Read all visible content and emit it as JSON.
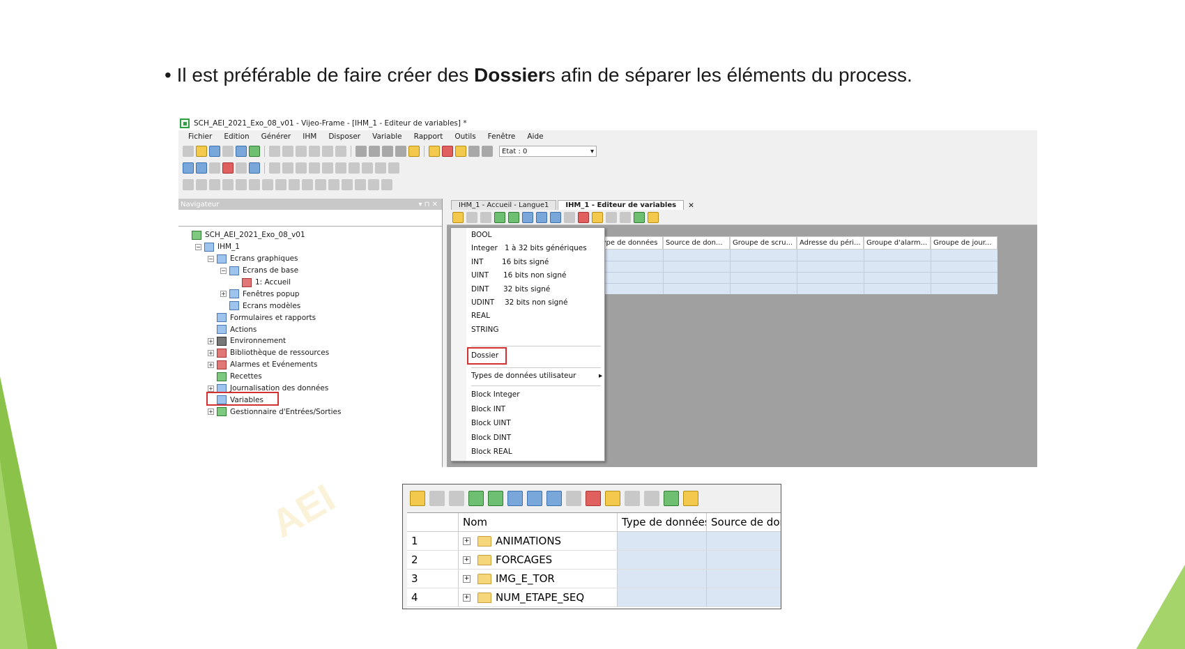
{
  "slide": {
    "bullet_prefix": "Il est préférable de faire créer des ",
    "bullet_bold": "Dossier",
    "bullet_suffix": "s afin de séparer les éléments du process.",
    "watermark": "AEI",
    "accent_color": "#8bc34a"
  },
  "app": {
    "title": "SCH_AEI_2021_Exo_08_v01 - Vijeo-Frame - [IHM_1 - Editeur de variables] *",
    "menu": [
      "Fichier",
      "Edition",
      "Générer",
      "IHM",
      "Disposer",
      "Variable",
      "Rapport",
      "Outils",
      "Fenêtre",
      "Aide"
    ],
    "etat_label": "Etat : 0",
    "navigator": {
      "header": "Navigateur",
      "tree": [
        {
          "label": "SCH_AEI_2021_Exo_08_v01",
          "level": 0,
          "icon": "project-icon"
        },
        {
          "label": "IHM_1",
          "level": 1,
          "icon": "hmi-icon"
        },
        {
          "label": "Ecrans graphiques",
          "level": 2,
          "icon": "screens-icon"
        },
        {
          "label": "Ecrans de base",
          "level": 3,
          "icon": "screens-icon"
        },
        {
          "label": "1: Accueil",
          "level": 4,
          "icon": "screen-page-icon"
        },
        {
          "label": "Fenêtres popup",
          "level": 3,
          "icon": "popup-icon"
        },
        {
          "label": "Ecrans modèles",
          "level": 3,
          "icon": "template-icon"
        },
        {
          "label": "Formulaires et rapports",
          "level": 2,
          "icon": "forms-icon"
        },
        {
          "label": "Actions",
          "level": 2,
          "icon": "actions-icon"
        },
        {
          "label": "Environnement",
          "level": 2,
          "icon": "environment-icon"
        },
        {
          "label": "Bibliothèque de ressources",
          "level": 2,
          "icon": "library-icon"
        },
        {
          "label": "Alarmes et Evénements",
          "level": 2,
          "icon": "alarms-icon"
        },
        {
          "label": "Recettes",
          "level": 2,
          "icon": "recipes-icon"
        },
        {
          "label": "Journalisation des données",
          "level": 2,
          "icon": "logging-icon"
        },
        {
          "label": "Variables",
          "level": 2,
          "icon": "variables-icon"
        },
        {
          "label": "Gestionnaire d'Entrées/Sorties",
          "level": 2,
          "icon": "io-manager-icon"
        }
      ]
    },
    "editor": {
      "tabs": [
        "IHM_1 - Accueil - Langue1",
        "IHM_1 - Editeur de variables"
      ],
      "columns": [
        "Type de données",
        "Source de don...",
        "Groupe de scru...",
        "Adresse du péri...",
        "Groupe d'alarm...",
        "Groupe de jour..."
      ]
    },
    "dropdown": {
      "items": [
        {
          "label": "BOOL",
          "desc": ""
        },
        {
          "label": "Integer",
          "desc": "1 à 32 bits génériques"
        },
        {
          "label": "INT",
          "desc": "16 bits signé"
        },
        {
          "label": "UINT",
          "desc": "16 bits non signé"
        },
        {
          "label": "DINT",
          "desc": "32 bits signé"
        },
        {
          "label": "UDINT",
          "desc": "32 bits non signé"
        },
        {
          "label": "REAL",
          "desc": ""
        },
        {
          "label": "STRING",
          "desc": ""
        }
      ],
      "dossier": "Dossier",
      "user_types": "Types de données utilisateur",
      "blocks": [
        "Block Integer",
        "Block INT",
        "Block UINT",
        "Block DINT",
        "Block REAL"
      ]
    }
  },
  "crop": {
    "columns": [
      "",
      "Nom",
      "Type de données",
      "Source de don."
    ],
    "rows": [
      {
        "num": "1",
        "name": "ANIMATIONS"
      },
      {
        "num": "2",
        "name": "FORCAGES"
      },
      {
        "num": "3",
        "name": "IMG_E_TOR"
      },
      {
        "num": "4",
        "name": "NUM_ETAPE_SEQ"
      }
    ]
  }
}
